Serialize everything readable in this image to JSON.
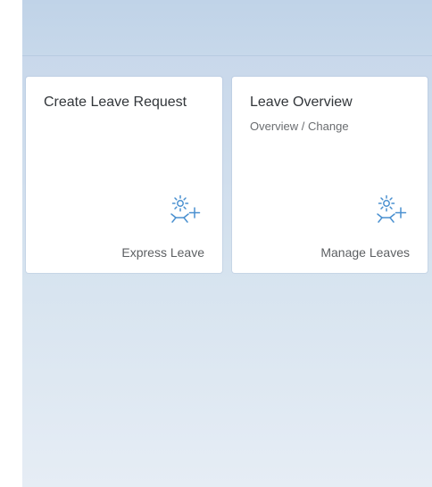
{
  "tiles": [
    {
      "title": "Create Leave Request",
      "subtitle": "",
      "footer": "Express Leave",
      "icon": "leave-request-icon"
    },
    {
      "title": "Leave Overview",
      "subtitle": "Overview / Change",
      "footer": "Manage Leaves",
      "icon": "leave-request-icon"
    }
  ],
  "colors": {
    "background": "#c6d7ea",
    "tile": "#ffffff",
    "icon": "#4a90d0",
    "title_text": "#32363a",
    "footer_text": "#5c5f62"
  }
}
